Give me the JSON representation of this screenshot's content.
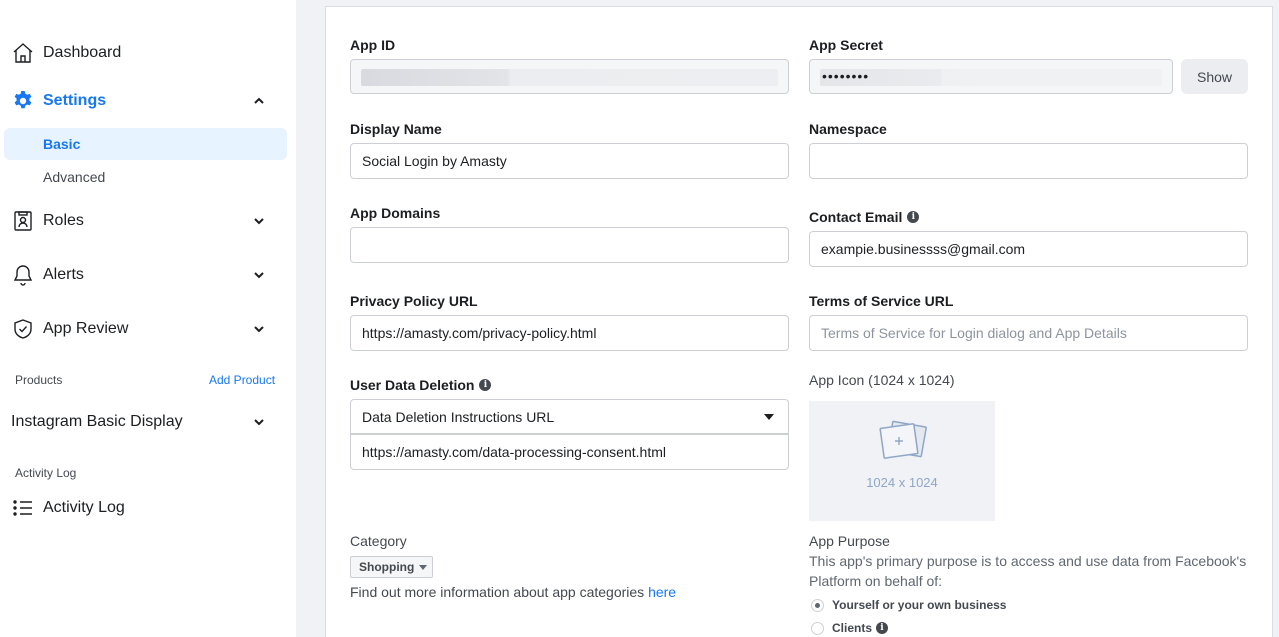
{
  "sidebar": {
    "dashboard": {
      "label": "Dashboard",
      "icon": "home-icon"
    },
    "settings": {
      "label": "Settings",
      "icon": "gear-icon"
    },
    "settings_basic": {
      "label": "Basic"
    },
    "settings_advanced": {
      "label": "Advanced"
    },
    "roles": {
      "label": "Roles",
      "icon": "roles-icon"
    },
    "alerts": {
      "label": "Alerts",
      "icon": "bell-icon"
    },
    "app_review": {
      "label": "App Review",
      "icon": "shield-check-icon"
    },
    "products_label": "Products",
    "add_product": "Add Product",
    "instagram": {
      "label": "Instagram Basic Display"
    },
    "activity_log_label": "Activity Log",
    "activity_log": {
      "label": "Activity Log",
      "icon": "list-icon"
    }
  },
  "form": {
    "app_id": {
      "label": "App ID",
      "value": ""
    },
    "app_secret": {
      "label": "App Secret",
      "value": "••••••••",
      "show_label": "Show"
    },
    "display_name": {
      "label": "Display Name",
      "value": "Social Login by Amasty"
    },
    "namespace": {
      "label": "Namespace",
      "value": ""
    },
    "app_domains": {
      "label": "App Domains",
      "value": ""
    },
    "contact_email": {
      "label": "Contact Email",
      "value": "exampie.businessss@gmail.com"
    },
    "privacy_policy_url": {
      "label": "Privacy Policy URL",
      "value": "https://amasty.com/privacy-policy.html"
    },
    "terms_of_service_url": {
      "label": "Terms of Service URL",
      "value": "",
      "placeholder": "Terms of Service for Login dialog and App Details"
    },
    "user_data_deletion": {
      "label": "User Data Deletion",
      "selected": "Data Deletion Instructions URL",
      "value": "https://amasty.com/data-processing-consent.html"
    },
    "app_icon": {
      "label": "App Icon (1024 x 1024)",
      "size_text": "1024 x 1024"
    },
    "category": {
      "label": "Category",
      "selected": "Shopping",
      "help_text": "Find out more information about app categories ",
      "help_link": "here"
    },
    "app_purpose": {
      "label": "App Purpose",
      "description": "This app's primary purpose is to access and use data from Facebook's Platform on behalf of:",
      "options": [
        {
          "label": "Yourself or your own business",
          "selected": true
        },
        {
          "label": "Clients",
          "selected": false
        }
      ]
    }
  },
  "colors": {
    "accent": "#1877f2",
    "selected_bg": "#e7f3ff",
    "page_bg": "#f0f2f5"
  }
}
